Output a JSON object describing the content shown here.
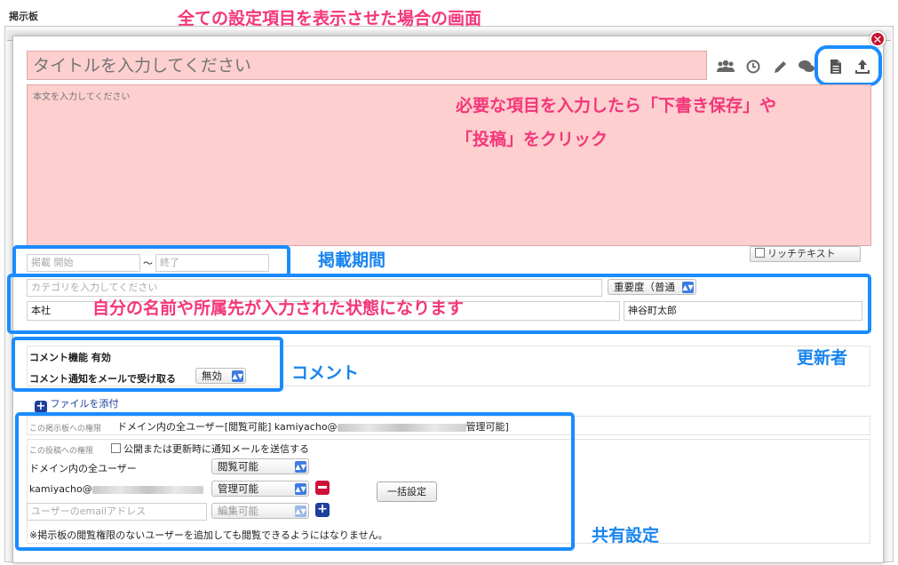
{
  "page": {
    "title": "掲示板"
  },
  "annotations": {
    "top_heading": "全ての設定項目を表示させた場合の画面",
    "save_post_line1": "必要な項目を入力したら「下書き保存」や",
    "save_post_line2": "「投稿」をクリック",
    "period": "掲載期間",
    "name_affiliation": "自分の名前や所属先が入力された状態になります",
    "updater": "更新者",
    "comment": "コメント",
    "sharing": "共有設定"
  },
  "editor": {
    "title_placeholder": "タイトルを入力してください",
    "body_placeholder": "本文を入力してください",
    "rich_text_label": "リッチテキスト",
    "toolbar_icons": [
      "users-icon",
      "clock-icon",
      "pencil-icon",
      "comments-icon",
      "document-icon",
      "upload-icon"
    ]
  },
  "period": {
    "start_placeholder": "掲載 開始",
    "separator": "〜",
    "end_placeholder": "終了"
  },
  "meta": {
    "category_placeholder": "カテゴリを入力してください",
    "importance_value": "重要度（普通",
    "affiliation_value": "本社",
    "author_value": "神谷町太郎"
  },
  "comment": {
    "feature_label": "コメント機能",
    "feature_status": "有効",
    "email_label": "コメント通知をメールで受け取る",
    "email_value": "無効"
  },
  "attach": {
    "label": "ファイルを添付"
  },
  "permissions": {
    "board_label": "この掲示板への権限",
    "board_text_1": "ドメイン内の全ユーザー[閲覧可能] kamiyacho@",
    "board_text_2": "管理可能]",
    "post_label": "この投稿への権限",
    "notify_label": "公開または更新時に通知メールを送信する",
    "rows": [
      {
        "user": "ドメイン内の全ユーザー",
        "permission": "閲覧可能"
      },
      {
        "user": "kamiyacho@",
        "permission": "管理可能"
      }
    ],
    "new_user_placeholder": "ユーザーのemailアドレス",
    "new_user_permission": "編集可能",
    "bulk_button": "一括設定",
    "note": "※掲示板の閲覧権限のないユーザーを追加しても閲覧できるようにはなりません。"
  },
  "colors": {
    "highlight": "#1a8cff",
    "annotation_pink": "#f4367a",
    "annotation_blue": "#1784f0",
    "required_bg": "#fdcfcf",
    "close": "#c8102e"
  }
}
